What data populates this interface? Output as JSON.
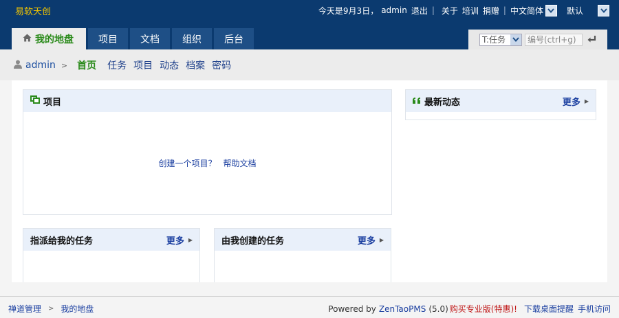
{
  "header": {
    "company": "易软天创",
    "today": "今天是9月3日，",
    "user": "admin",
    "logout": "退出",
    "about": "关于",
    "training": "培训",
    "donate": "捐赠",
    "lang": "中文简体",
    "theme": "默认"
  },
  "nav": {
    "tabs": [
      {
        "label": "我的地盘"
      },
      {
        "label": "项目"
      },
      {
        "label": "文档"
      },
      {
        "label": "组织"
      },
      {
        "label": "后台"
      }
    ]
  },
  "search": {
    "type": "T:任务",
    "placeholder": "编号(ctrl+g)"
  },
  "subnav": {
    "user": "admin",
    "items": [
      {
        "label": "首页"
      },
      {
        "label": "任务"
      },
      {
        "label": "项目"
      },
      {
        "label": "动态"
      },
      {
        "label": "档案"
      },
      {
        "label": "密码"
      }
    ]
  },
  "panels": {
    "project": {
      "title": "项目",
      "create_link": "创建一个项目？",
      "help_link": "帮助文档"
    },
    "dynamic": {
      "title": "最新动态",
      "more": "更多"
    },
    "assigned": {
      "title": "指派给我的任务",
      "more": "更多"
    },
    "created": {
      "title": "由我创建的任务",
      "more": "更多"
    }
  },
  "footer": {
    "crumb1": "禅道管理",
    "crumb2": "我的地盘",
    "powered_by": "Powered by",
    "product": "ZenTaoPMS",
    "version": "(5.0)",
    "buy": "购买专业版(特惠)!",
    "download": "下载桌面提醒",
    "mobile": "手机访问"
  },
  "colors": {
    "header_bg": "#0b3a6f",
    "tab_bg": "#1e4f86",
    "active_green": "#2a8a1a",
    "company_yellow": "#f2c400",
    "panel_head_bg": "#e9f0fa"
  }
}
